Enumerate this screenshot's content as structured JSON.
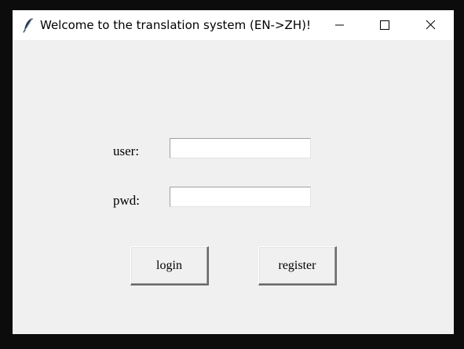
{
  "window": {
    "title": "Welcome to the translation system (EN->ZH)!",
    "icon": "feather-icon",
    "controls": {
      "minimize": "minimize-icon",
      "maximize": "maximize-icon",
      "close": "close-icon"
    }
  },
  "form": {
    "user_label": "user:",
    "user_value": "",
    "pwd_label": "pwd:",
    "pwd_value": "",
    "login_label": "login",
    "register_label": "register"
  }
}
